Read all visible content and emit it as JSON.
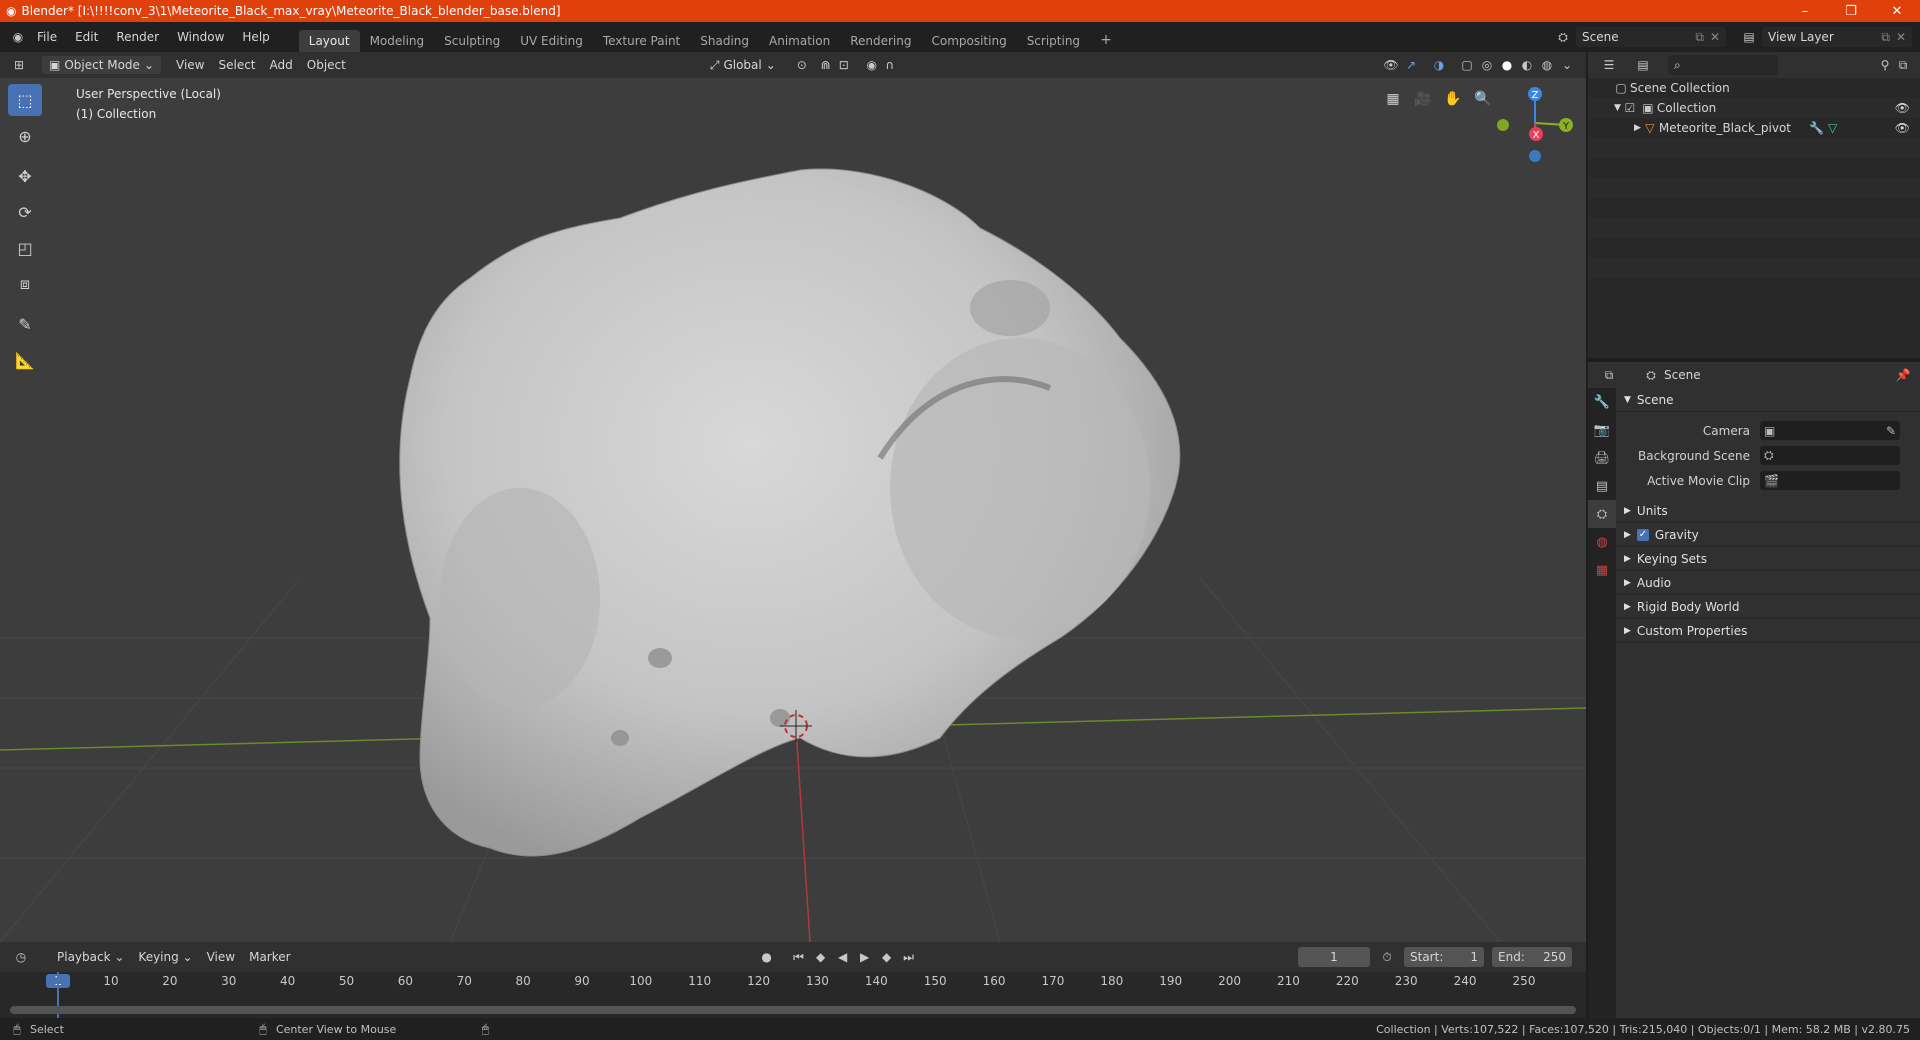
{
  "window": {
    "title": "Blender* [I:\\!!!!conv_3\\1\\Meteorite_Black_max_vray\\Meteorite_Black_blender_base.blend]",
    "minimize": "–",
    "maximize": "❐",
    "close": "✕"
  },
  "menus": [
    "File",
    "Edit",
    "Render",
    "Window",
    "Help"
  ],
  "workspaces": [
    "Layout",
    "Modeling",
    "Sculpting",
    "UV Editing",
    "Texture Paint",
    "Shading",
    "Animation",
    "Rendering",
    "Compositing",
    "Scripting"
  ],
  "workspace_add": "+",
  "scene_selector": "Scene",
  "view_layer": "View Layer",
  "viewport_header": {
    "mode": "Object Mode",
    "view": "View",
    "select": "Select",
    "add": "Add",
    "object": "Object",
    "orientation": "Global"
  },
  "viewport": {
    "perspective": "User Perspective (Local)",
    "collection": "(1) Collection",
    "axis_x": "X",
    "axis_y": "Y",
    "axis_z": "Z"
  },
  "outliner": {
    "scene_collection": "Scene Collection",
    "collection": "Collection",
    "object": "Meteorite_Black_pivot"
  },
  "properties": {
    "context": "Scene",
    "panel_scene": "Scene",
    "camera_label": "Camera",
    "bg_scene_label": "Background Scene",
    "movie_clip_label": "Active Movie Clip",
    "panels": [
      "Units",
      "Gravity",
      "Keying Sets",
      "Audio",
      "Rigid Body World",
      "Custom Properties"
    ]
  },
  "timeline": {
    "playback": "Playback",
    "keying": "Keying",
    "view": "View",
    "marker": "Marker",
    "current_frame": "1",
    "start_label": "Start:",
    "start": "1",
    "end_label": "End:",
    "end": "250",
    "ticks": [
      "1",
      "10",
      "20",
      "30",
      "40",
      "50",
      "60",
      "70",
      "80",
      "90",
      "100",
      "110",
      "120",
      "130",
      "140",
      "150",
      "160",
      "170",
      "180",
      "190",
      "200",
      "210",
      "220",
      "230",
      "240",
      "250"
    ]
  },
  "status": {
    "select": "Select",
    "center_view": "Center View to Mouse",
    "stats": "Collection | Verts:107,522 | Faces:107,520 | Tris:215,040 | Objects:0/1 | Mem: 58.2 MB | v2.80.75"
  },
  "colors": {
    "titlebar": "#e0400b",
    "accent": "#4772b3",
    "axis_x": "#e8405a",
    "axis_y": "#8bb023",
    "axis_z": "#3d88dd"
  }
}
